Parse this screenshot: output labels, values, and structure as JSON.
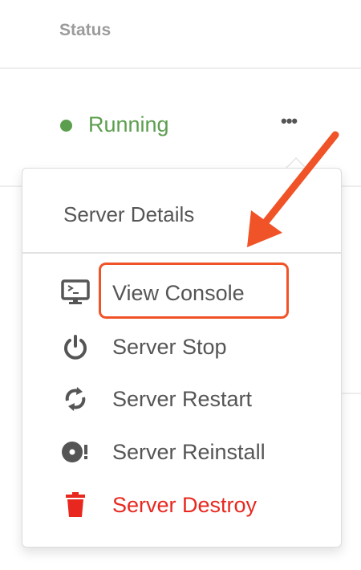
{
  "table": {
    "status_header": "Status",
    "row": {
      "status": "Running",
      "status_color": "#5b9e4d",
      "more_label": "•••"
    }
  },
  "menu": {
    "title": "Server Details",
    "items": [
      {
        "label": "View Console",
        "icon": "monitor-console-icon"
      },
      {
        "label": "Server Stop",
        "icon": "power-icon"
      },
      {
        "label": "Server Restart",
        "icon": "refresh-icon"
      },
      {
        "label": "Server Reinstall",
        "icon": "disc-alert-icon"
      },
      {
        "label": "Server Destroy",
        "icon": "trash-icon",
        "color": "#e8281f"
      }
    ]
  },
  "annotation": {
    "color": "#f05328"
  }
}
